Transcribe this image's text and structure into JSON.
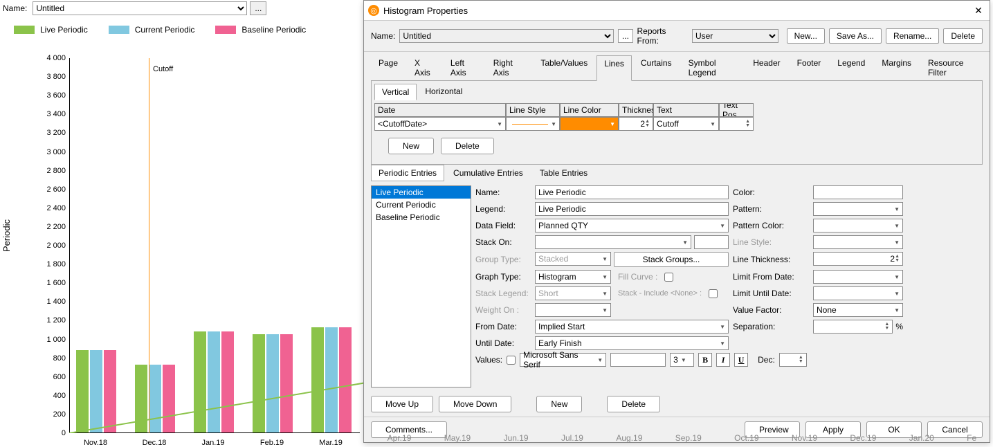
{
  "topbar": {
    "name_label": "Name:",
    "name_value": "Untitled",
    "ellipsis": "..."
  },
  "legend": {
    "live": "Live Periodic",
    "current": "Current Periodic",
    "baseline": "Baseline Periodic"
  },
  "yaxis_label": "Periodic",
  "cutoff_label": "Cutoff",
  "chart_data": {
    "type": "bar",
    "ylabel": "Periodic",
    "ylim": [
      0,
      4000
    ],
    "ytick_step": 200,
    "categories": [
      "Nov.18",
      "Dec.18",
      "Jan.19",
      "Feb.19",
      "Mar.19"
    ],
    "series": [
      {
        "name": "Live Periodic",
        "color": "#8bc34a",
        "values": [
          880,
          720,
          1080,
          1050,
          1120
        ]
      },
      {
        "name": "Current Periodic",
        "color": "#81c8e0",
        "values": [
          880,
          720,
          1080,
          1050,
          1120
        ]
      },
      {
        "name": "Baseline Periodic",
        "color": "#f06292",
        "values": [
          880,
          720,
          1080,
          1050,
          1120
        ]
      }
    ],
    "cutoff_category": "Dec.18",
    "cutoff_line_color": "#ff8c00"
  },
  "dialog": {
    "title": "Histogram Properties",
    "top": {
      "name_label": "Name:",
      "name_value": "Untitled",
      "ellipsis": "...",
      "reports_from_label": "Reports From:",
      "reports_from_value": "User",
      "new": "New...",
      "save_as": "Save As...",
      "rename": "Rename...",
      "delete": "Delete"
    },
    "tabs": [
      "Page",
      "X Axis",
      "Left Axis",
      "Right Axis",
      "Table/Values",
      "Lines",
      "Curtains",
      "Symbol Legend",
      "Header",
      "Footer",
      "Legend",
      "Margins",
      "Resource Filter"
    ],
    "active_tab": "Lines",
    "subtabs": {
      "vertical": "Vertical",
      "horizontal": "Horizontal"
    },
    "lines_table": {
      "headers": {
        "date": "Date",
        "line_style": "Line Style",
        "line_color": "Line Color",
        "thickness": "Thickness",
        "text": "Text",
        "text_pos": "Text Pos"
      },
      "row": {
        "date": "<CutoffDate>",
        "line_color": "#ff8c00",
        "thickness": "2",
        "text": "Cutoff"
      }
    },
    "lt_buttons": {
      "new": "New",
      "delete": "Delete"
    },
    "entry_tabs": {
      "periodic": "Periodic Entries",
      "cumulative": "Cumulative Entries",
      "table": "Table Entries"
    },
    "entries": [
      "Live Periodic",
      "Current Periodic",
      "Baseline Periodic"
    ],
    "props": {
      "name_l": "Name:",
      "name_v": "Live Periodic",
      "legend_l": "Legend:",
      "legend_v": "Live Periodic",
      "datafield_l": "Data Field:",
      "datafield_v": "Planned QTY",
      "stackon_l": "Stack On:",
      "grouptype_l": "Group Type:",
      "grouptype_v": "Stacked",
      "stackgroups": "Stack Groups...",
      "graphtype_l": "Graph Type:",
      "graphtype_v": "Histogram",
      "fillcurve_l": "Fill Curve :",
      "stacklegend_l": "Stack Legend:",
      "stacklegend_v": "Short",
      "stackinclude_l": "Stack - Include <None> :",
      "weighton_l": "Weight On :",
      "fromdate_l": "From Date:",
      "fromdate_v": "Implied Start",
      "untildate_l": "Until Date:",
      "untildate_v": "Early Finish",
      "values_l": "Values:",
      "font_v": "Microsoft Sans Serif",
      "size_v": "3",
      "dec_l": "Dec:",
      "color_l": "Color:",
      "color_v": "#8bc34a",
      "pattern_l": "Pattern:",
      "patterncolor_l": "Pattern Color:",
      "linestyle_l": "Line Style:",
      "linethick_l": "Line Thickness:",
      "linethick_v": "2",
      "limitfrom_l": "Limit From Date:",
      "limituntil_l": "Limit Until Date:",
      "valuefactor_l": "Value Factor:",
      "valuefactor_v": "None",
      "separation_l": "Separation:",
      "pct": "%"
    },
    "entry_btns": {
      "moveup": "Move Up",
      "movedown": "Move Down",
      "new": "New",
      "delete": "Delete"
    },
    "footer": {
      "comments": "Comments...",
      "preview": "Preview",
      "apply": "Apply",
      "ok": "OK",
      "cancel": "Cancel"
    }
  },
  "bg_xticks": [
    "Apr.19",
    "May.19",
    "Jun.19",
    "Jul.19",
    "Aug.19",
    "Sep.19",
    "Oct.19",
    "Nov.19",
    "Dec.19",
    "Jan.20",
    "Fe"
  ]
}
